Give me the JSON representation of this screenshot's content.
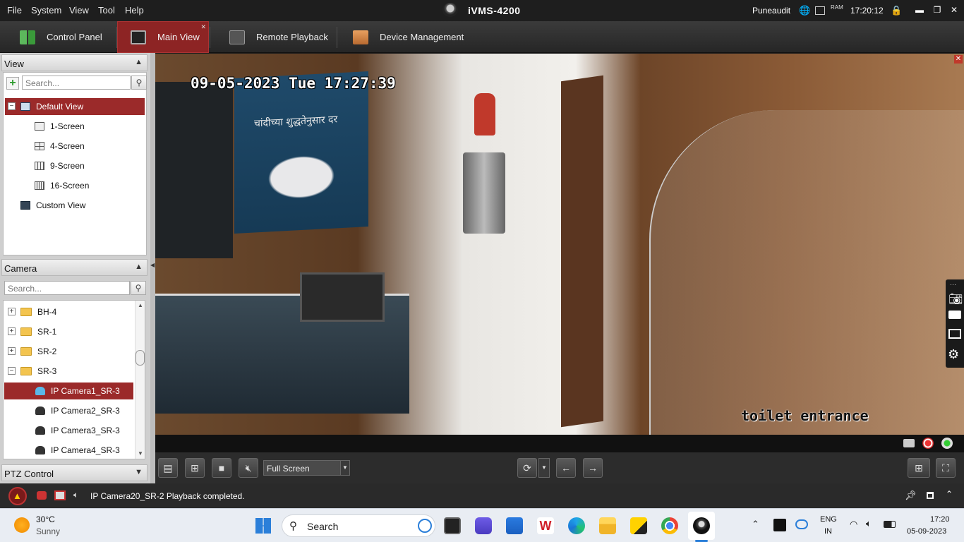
{
  "titlebar": {
    "menu": [
      "File",
      "System",
      "View",
      "Tool",
      "Help"
    ],
    "app_title": "iVMS-4200",
    "user": "Puneaudit",
    "ram_label": "RAM",
    "clock": "17:20:12"
  },
  "tabs": [
    {
      "label": "Control Panel",
      "active": false
    },
    {
      "label": "Main View",
      "active": true
    },
    {
      "label": "Remote Playback",
      "active": false
    },
    {
      "label": "Device Management",
      "active": false
    }
  ],
  "view_panel": {
    "title": "View",
    "search_placeholder": "Search...",
    "default_view": "Default View",
    "screens": [
      "1-Screen",
      "4-Screen",
      "9-Screen",
      "16-Screen"
    ],
    "custom_view": "Custom View"
  },
  "camera_panel": {
    "title": "Camera",
    "search_placeholder": "Search...",
    "groups": [
      "BH-4",
      "SR-1",
      "SR-2",
      "SR-3"
    ],
    "cameras": [
      "IP Camera1_SR-3",
      "IP Camera2_SR-3",
      "IP Camera3_SR-3",
      "IP Camera4_SR-3"
    ],
    "selected_camera": "IP Camera1_SR-3"
  },
  "ptz_panel": {
    "title": "PTZ Control"
  },
  "video": {
    "osd_timestamp": "09-05-2023 Tue 17:27:39",
    "osd_label": "toilet entrance",
    "sign_text": "चांदीच्या शुद्धतेनुसार दर"
  },
  "controls": {
    "display_mode": "Full Screen"
  },
  "status": {
    "message": "IP Camera20_SR-2 Playback completed."
  },
  "taskbar": {
    "weather_temp": "30°C",
    "weather_desc": "Sunny",
    "search_label": "Search",
    "lang_top": "ENG",
    "lang_bottom": "IN",
    "time": "17:20",
    "date": "05-09-2023"
  },
  "colors": {
    "accent": "#9b2a2a",
    "titlebar": "#1e1e1e",
    "panel_bg": "#cfcfcf"
  }
}
